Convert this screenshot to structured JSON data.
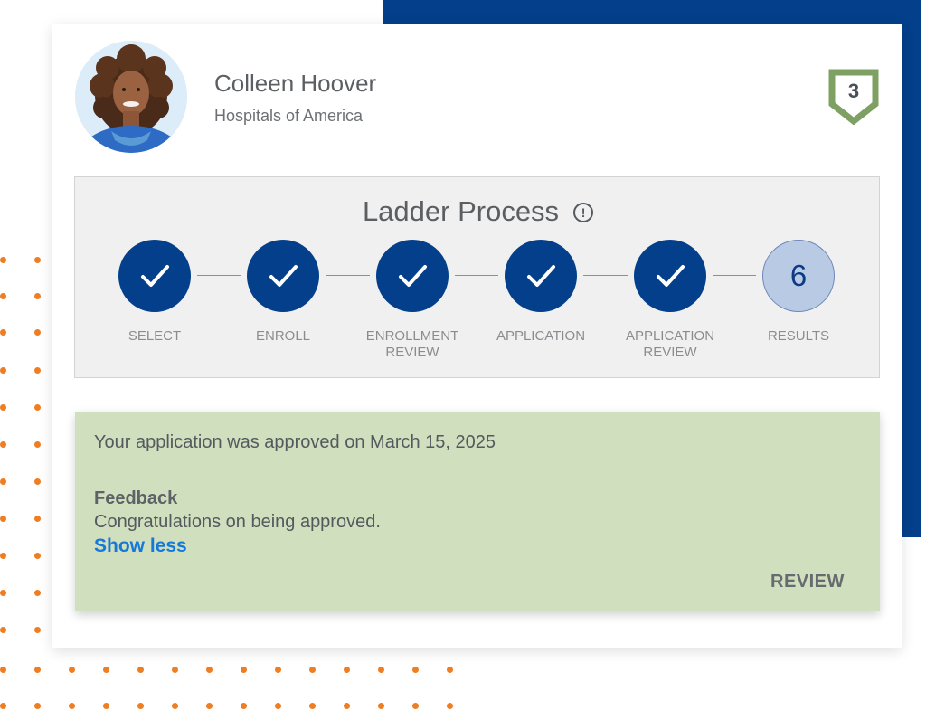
{
  "profile": {
    "name": "Colleen Hoover",
    "organization": "Hospitals of America",
    "level": "3"
  },
  "ladder": {
    "title": "Ladder Process",
    "info_icon": "!",
    "steps": [
      {
        "label": "SELECT",
        "status": "complete",
        "icon": "check-icon"
      },
      {
        "label": "ENROLL",
        "status": "complete",
        "icon": "check-icon"
      },
      {
        "label": "ENROLLMENT\nREVIEW",
        "status": "complete",
        "icon": "check-icon"
      },
      {
        "label": "APPLICATION",
        "status": "complete",
        "icon": "check-icon"
      },
      {
        "label": "APPLICATION\nREVIEW",
        "status": "complete",
        "icon": "check-icon"
      },
      {
        "label": "RESULTS",
        "status": "current",
        "number": "6"
      }
    ]
  },
  "status": {
    "message": "Your application was approved on March 15, 2025",
    "feedback_heading": "Feedback",
    "feedback_text": "Congratulations on being approved.",
    "show_less_label": "Show less",
    "review_label": "REVIEW"
  },
  "colors": {
    "brand_blue": "#033f8a",
    "current_step": "#b9cae5",
    "success_panel": "#d0dfbd",
    "badge_green": "#7fa063",
    "link_blue": "#1479d9",
    "accent_orange": "#ef7d22"
  }
}
